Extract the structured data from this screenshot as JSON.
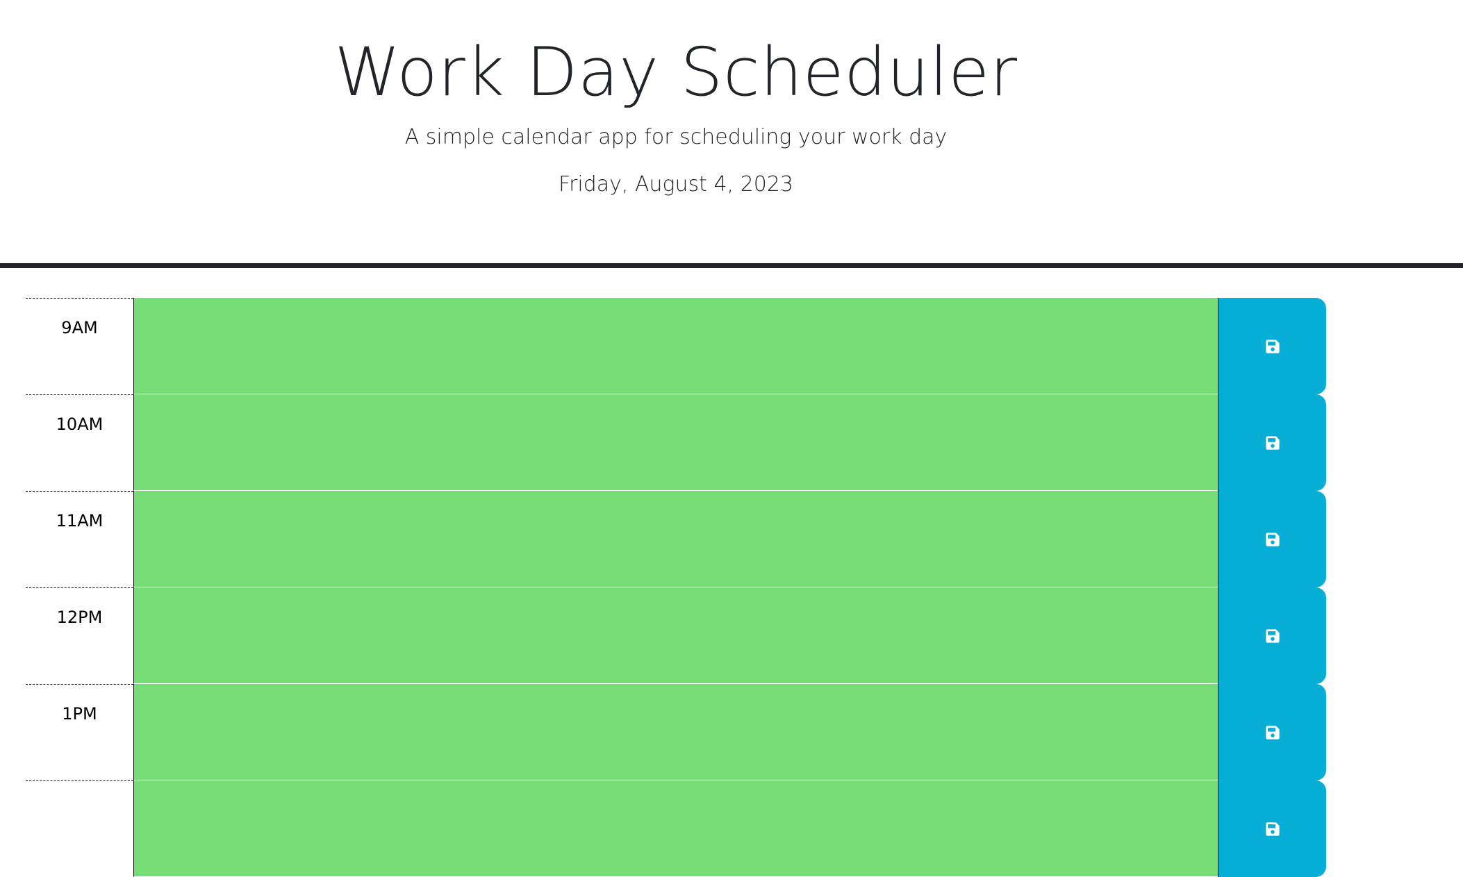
{
  "header": {
    "title": "Work Day Scheduler",
    "subtitle": "A simple calendar app for scheduling your work day",
    "current_day": "Friday, August 4, 2023"
  },
  "colors": {
    "present_or_future_block": "#77dd77",
    "save_button": "#06aed5",
    "divider": "#212529"
  },
  "time_blocks": [
    {
      "hour": "9AM",
      "text": "",
      "save_icon": "save-icon"
    },
    {
      "hour": "10AM",
      "text": "",
      "save_icon": "save-icon"
    },
    {
      "hour": "11AM",
      "text": "",
      "save_icon": "save-icon"
    },
    {
      "hour": "12PM",
      "text": "",
      "save_icon": "save-icon"
    },
    {
      "hour": "1PM",
      "text": "",
      "save_icon": "save-icon"
    },
    {
      "hour": "",
      "text": "",
      "save_icon": "save-icon"
    }
  ]
}
